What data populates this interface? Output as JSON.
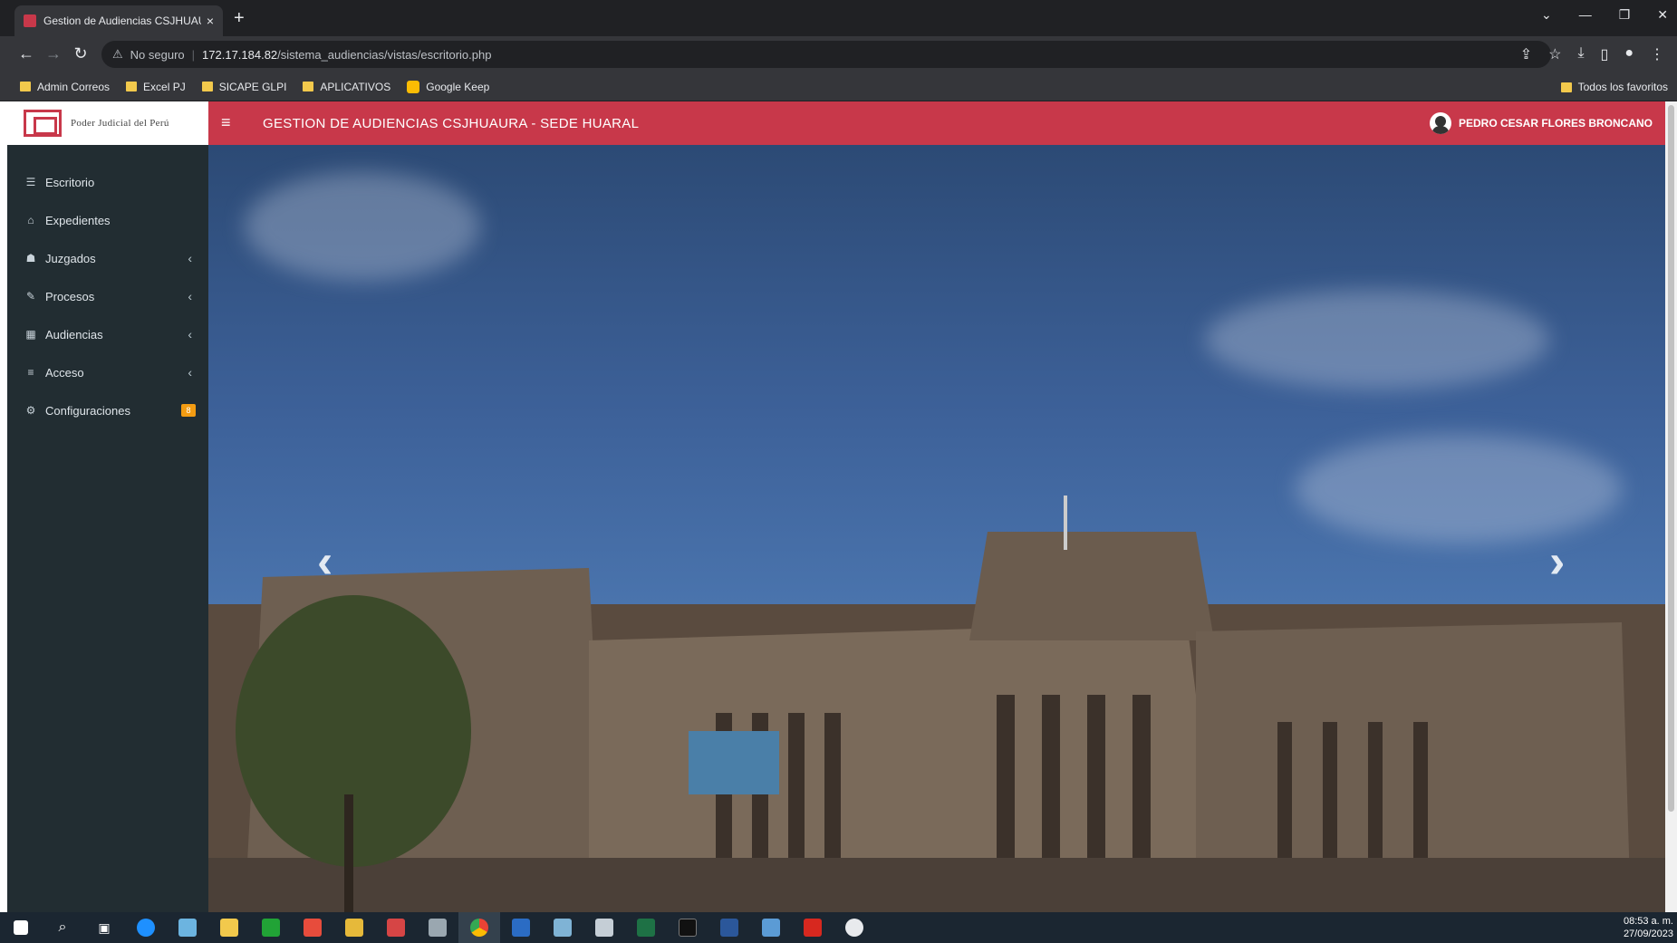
{
  "browser": {
    "tab_title": "Gestion de Audiencias CSJHUAURA",
    "security_label": "No seguro",
    "url_host": "172.17.184.82",
    "url_path": "/sistema_audiencias/vistas/escritorio.php",
    "bookmarks": [
      "Admin Correos",
      "Excel PJ",
      "SICAPE GLPI",
      "APLICATIVOS",
      "Google Keep"
    ],
    "all_favorites": "Todos los favoritos"
  },
  "app": {
    "logo_text": "Poder Judicial del Perú",
    "title": "GESTION DE AUDIENCIAS CSJHUAURA - SEDE HUARAL",
    "user_name": "PEDRO CESAR FLORES BRONCANO",
    "accent_color": "#c8384a",
    "sidebar": [
      {
        "label": "Escritorio",
        "icon": "desktop-icon",
        "glyph": "☰",
        "chevron": ""
      },
      {
        "label": "Expedientes",
        "icon": "folder-open-icon",
        "glyph": "⌂",
        "chevron": ""
      },
      {
        "label": "Juzgados",
        "icon": "users-icon",
        "glyph": "☗",
        "chevron": "‹"
      },
      {
        "label": "Procesos",
        "icon": "tags-icon",
        "glyph": "✎",
        "chevron": "‹"
      },
      {
        "label": "Audiencias",
        "icon": "calendar-icon",
        "glyph": "▦",
        "chevron": "‹"
      },
      {
        "label": "Acceso",
        "icon": "database-icon",
        "glyph": "≡",
        "chevron": "‹"
      },
      {
        "label": "Configuraciones",
        "icon": "cogs-icon",
        "glyph": "⚙",
        "badge": "8"
      }
    ]
  },
  "carousel": {
    "prev": "‹",
    "next": "›"
  },
  "taskbar": {
    "time": "08:53 a. m.",
    "date": "27/09/2023"
  }
}
